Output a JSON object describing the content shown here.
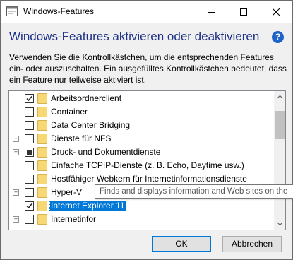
{
  "window": {
    "title": "Windows-Features"
  },
  "caption": {
    "minimize_icon": "minimize-icon",
    "maximize_icon": "maximize-icon",
    "close_icon": "close-icon"
  },
  "header": {
    "heading": "Windows-Features aktivieren oder deaktivieren",
    "help_symbol": "?"
  },
  "description": "Verwenden Sie die Kontrollkästchen, um die entsprechenden Features ein- oder auszuschalten. Ein ausgefülltes Kontrollkästchen bedeutet, dass ein Feature nur teilweise aktiviert ist.",
  "features": [
    {
      "label": "Arbeitsordnerclient",
      "state": "checked",
      "expandable": false,
      "selected": false
    },
    {
      "label": "Container",
      "state": "unchecked",
      "expandable": false,
      "selected": false
    },
    {
      "label": "Data Center Bridging",
      "state": "unchecked",
      "expandable": false,
      "selected": false
    },
    {
      "label": "Dienste für NFS",
      "state": "unchecked",
      "expandable": true,
      "selected": false
    },
    {
      "label": "Druck- und Dokumentdienste",
      "state": "partial",
      "expandable": true,
      "selected": false
    },
    {
      "label": "Einfache TCPIP-Dienste (z. B. Echo, Daytime usw.)",
      "state": "unchecked",
      "expandable": false,
      "selected": false
    },
    {
      "label": "Hostfähiger Webkern für Internetinformationsdienste",
      "state": "unchecked",
      "expandable": false,
      "selected": false
    },
    {
      "label": "Hyper-V",
      "state": "unchecked",
      "expandable": true,
      "selected": false
    },
    {
      "label": "Internet Explorer 11",
      "state": "checked",
      "expandable": false,
      "selected": true
    },
    {
      "label": "Internetinfor",
      "state": "unchecked",
      "expandable": true,
      "selected": false
    }
  ],
  "tooltip": "Finds and displays information and Web sites on the",
  "buttons": {
    "ok": "OK",
    "cancel": "Abbrechen"
  },
  "colors": {
    "heading": "#1e3287",
    "selection": "#0078d7",
    "folder": "#f8d775",
    "help": "#1e64c8"
  }
}
